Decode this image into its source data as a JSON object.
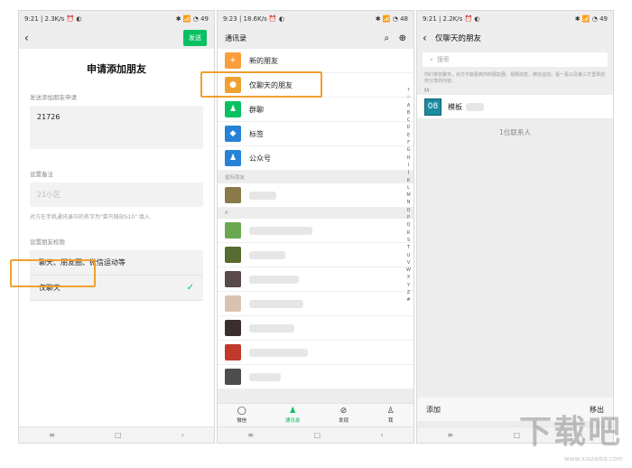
{
  "panel1": {
    "status_left": "9:21 | 2.3K/s ⏰ ◐",
    "status_right": "✱ 📶 ◔ 49",
    "send_label": "发送",
    "title": "申请添加朋友",
    "request_label": "发送添加朋友申请",
    "request_value": "21726",
    "remark_label": "设置备注",
    "remark_value": "21小区",
    "remark_note": "对方在手机通讯录中的名字为\"菜鸟骑站510\" 填入",
    "perm_label": "设置朋友权限",
    "perm_options": [
      "聊天、朋友圈、微信运动等",
      "仅聊天"
    ]
  },
  "panel2": {
    "status_left": "9:23 | 18.6K/s ⏰ ◐",
    "status_right": "✱ 📶 ◔ 48",
    "header": "通讯录",
    "functions": [
      "新的朋友",
      "仅聊天的朋友",
      "群聊",
      "标签",
      "公众号"
    ],
    "section_star": "星标朋友",
    "section_a": "A",
    "alphabet": [
      "↑",
      "☆",
      "A",
      "B",
      "C",
      "D",
      "E",
      "F",
      "G",
      "H",
      "I",
      "J",
      "K",
      "L",
      "M",
      "N",
      "O",
      "P",
      "Q",
      "R",
      "S",
      "T",
      "U",
      "V",
      "W",
      "X",
      "Y",
      "Z",
      "#"
    ],
    "tabs": [
      "微信",
      "通讯录",
      "发现",
      "我"
    ]
  },
  "panel3": {
    "status_left": "9:21 | 2.2K/s ⏰ ◐",
    "status_right": "✱ 📶 ◔ 49",
    "title": "仅聊天的朋友",
    "search_placeholder": "搜索",
    "desc": "你们将仅聊天，对方不能看到你的朋友圈、视频动态、微信运动，看一看以及第三方登录授权分享的内容。",
    "letter": "M",
    "contact_avatar": "08",
    "contact_name": "模板",
    "count": "1位联系人",
    "add_label": "添加",
    "remove_label": "移出"
  },
  "watermark": {
    "text": "下载吧",
    "sub": "www.xiazaiba.com"
  },
  "colors": {
    "wechat_green": "#07c160",
    "highlight": "#f0a030"
  }
}
